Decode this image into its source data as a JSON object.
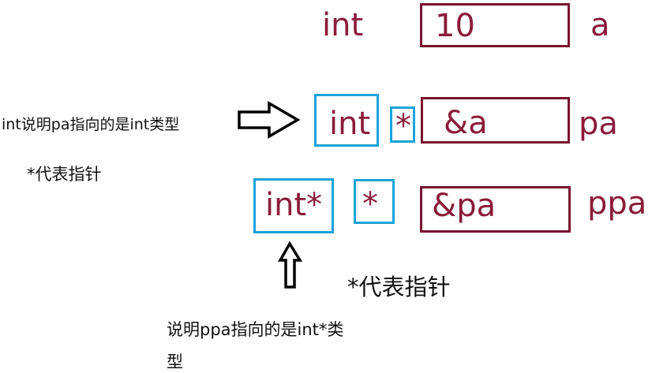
{
  "row1": {
    "type": "int",
    "value": "10",
    "name": "a"
  },
  "row2": {
    "type": "int",
    "star": "*",
    "value": "&a",
    "name": "pa"
  },
  "row3": {
    "type": "int*",
    "star": "*",
    "value": "&pa",
    "name": "ppa"
  },
  "notes": {
    "left_top": "int说明pa指向的是int类型",
    "left_star": "*代表指针",
    "mid_star": "*代表指针",
    "bottom_line1": "说明ppa指向的是int*类",
    "bottom_line2": "型"
  },
  "colors": {
    "maroon": "#7a1230",
    "blue": "#1aa3d9",
    "text": "#8a1c3a"
  }
}
